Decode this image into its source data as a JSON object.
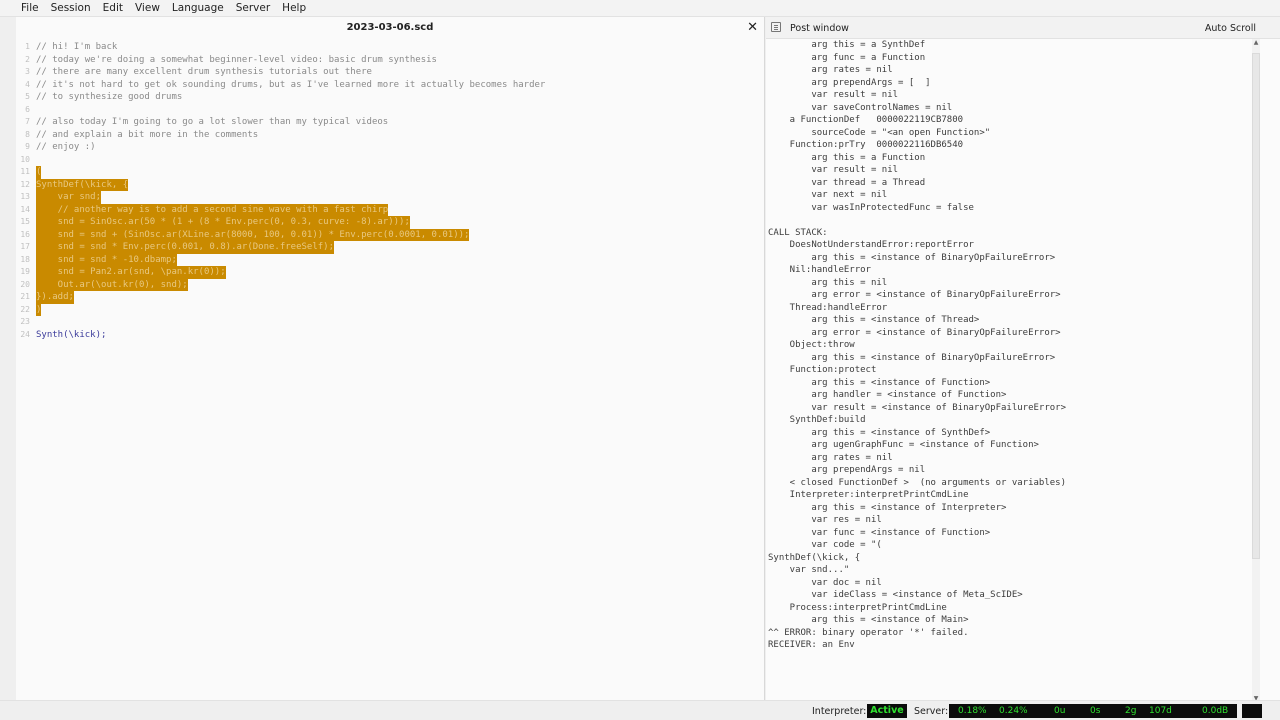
{
  "menu": [
    "File",
    "Session",
    "Edit",
    "View",
    "Language",
    "Server",
    "Help"
  ],
  "editor": {
    "tab_title": "2023-03-06.scd",
    "close_glyph": "✕",
    "lines": [
      {
        "n": "1",
        "text": "// hi! I'm back",
        "kind": "comment"
      },
      {
        "n": "2",
        "text": "// today we're doing a somewhat beginner-level video: basic drum synthesis",
        "kind": "comment"
      },
      {
        "n": "3",
        "text": "// there are many excellent drum synthesis tutorials out there",
        "kind": "comment"
      },
      {
        "n": "4",
        "text": "// it's not hard to get ok sounding drums, but as I've learned more it actually becomes harder",
        "kind": "comment"
      },
      {
        "n": "5",
        "text": "// to synthesize good drums",
        "kind": "comment"
      },
      {
        "n": "6",
        "text": "",
        "kind": "comment"
      },
      {
        "n": "7",
        "text": "// also today I'm going to go a lot slower than my typical videos",
        "kind": "comment"
      },
      {
        "n": "8",
        "text": "// and explain a bit more in the comments",
        "kind": "comment"
      },
      {
        "n": "9",
        "text": "// enjoy :)",
        "kind": "comment"
      },
      {
        "n": "10",
        "text": "",
        "kind": "comment"
      },
      {
        "n": "11",
        "text": "(",
        "kind": "sel"
      },
      {
        "n": "12",
        "text": "SynthDef(\\kick, {",
        "kind": "sel"
      },
      {
        "n": "13",
        "text": "    var snd;",
        "kind": "sel"
      },
      {
        "n": "14",
        "text": "    // another way is to add a second sine wave with a fast chirp",
        "kind": "sel"
      },
      {
        "n": "15",
        "text": "    snd = SinOsc.ar(50 * (1 + (8 * Env.perc(0, 0.3, curve: -8).ar)));",
        "kind": "sel"
      },
      {
        "n": "16",
        "text": "    snd = snd + (SinOsc.ar(XLine.ar(8000, 100, 0.01)) * Env.perc(0.0001, 0.01));",
        "kind": "sel"
      },
      {
        "n": "17",
        "text": "    snd = snd * Env.perc(0.001, 0.8).ar(Done.freeSelf);",
        "kind": "sel"
      },
      {
        "n": "18",
        "text": "    snd = snd * -10.dbamp;",
        "kind": "sel"
      },
      {
        "n": "19",
        "text": "    snd = Pan2.ar(snd, \\pan.kr(0));",
        "kind": "sel"
      },
      {
        "n": "20",
        "text": "    Out.ar(\\out.kr(0), snd);",
        "kind": "sel"
      },
      {
        "n": "21",
        "text": "}).add;",
        "kind": "sel"
      },
      {
        "n": "22",
        "text": ")",
        "kind": "sel"
      },
      {
        "n": "23",
        "text": "",
        "kind": "plain"
      },
      {
        "n": "24",
        "text": "Synth(\\kick);",
        "kind": "plain"
      }
    ]
  },
  "post": {
    "title": "Post window",
    "auto_scroll": "Auto Scroll",
    "lines": [
      "        arg this = a SynthDef",
      "        arg func = a Function",
      "        arg rates = nil",
      "        arg prependArgs = [  ]",
      "        var result = nil",
      "        var saveControlNames = nil",
      "    a FunctionDef   0000022119CB7800",
      "        sourceCode = \"<an open Function>\"",
      "    Function:prTry  0000022116DB6540",
      "        arg this = a Function",
      "        var result = nil",
      "        var thread = a Thread",
      "        var next = nil",
      "        var wasInProtectedFunc = false",
      "",
      "CALL STACK:",
      "    DoesNotUnderstandError:reportError",
      "        arg this = <instance of BinaryOpFailureError>",
      "    Nil:handleError",
      "        arg this = nil",
      "        arg error = <instance of BinaryOpFailureError>",
      "    Thread:handleError",
      "        arg this = <instance of Thread>",
      "        arg error = <instance of BinaryOpFailureError>",
      "    Object:throw",
      "        arg this = <instance of BinaryOpFailureError>",
      "    Function:protect",
      "        arg this = <instance of Function>",
      "        arg handler = <instance of Function>",
      "        var result = <instance of BinaryOpFailureError>",
      "    SynthDef:build",
      "        arg this = <instance of SynthDef>",
      "        arg ugenGraphFunc = <instance of Function>",
      "        arg rates = nil",
      "        arg prependArgs = nil",
      "    < closed FunctionDef >  (no arguments or variables)",
      "    Interpreter:interpretPrintCmdLine",
      "        arg this = <instance of Interpreter>",
      "        var res = nil",
      "        var func = <instance of Function>",
      "        var code = \"(",
      "SynthDef(\\kick, {",
      "    var snd...\"",
      "        var doc = nil",
      "        var ideClass = <instance of Meta_ScIDE>",
      "    Process:interpretPrintCmdLine",
      "        arg this = <instance of Main>",
      "^^ ERROR: binary operator '*' failed.",
      "RECEIVER: an Env"
    ]
  },
  "status": {
    "interpreter_label": "Interpreter:",
    "interpreter_state": "Active",
    "server_label": "Server:",
    "metrics": [
      "0.18%",
      "0.24%",
      "0u",
      "0s",
      "2g",
      "107d",
      "0.0dB"
    ]
  },
  "colors": {
    "selection": "#c98a00",
    "status_green": "#2fe02f"
  }
}
